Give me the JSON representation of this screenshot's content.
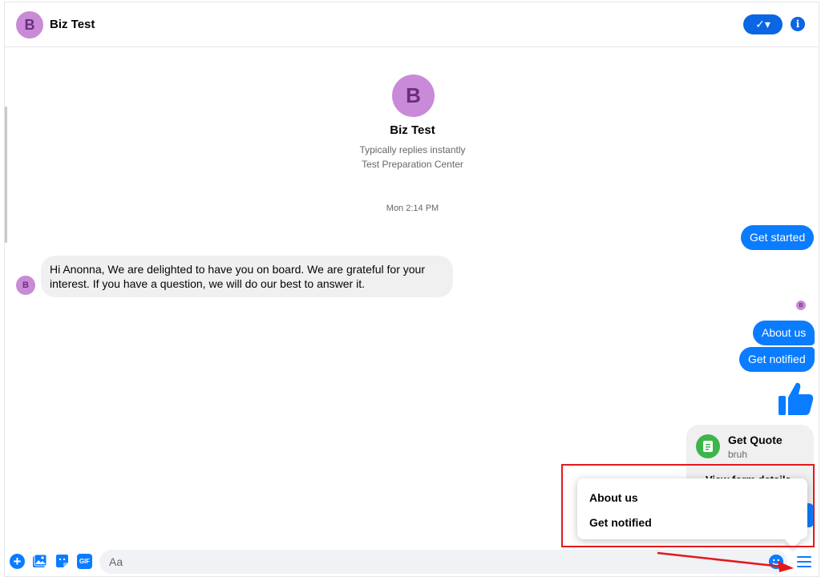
{
  "header": {
    "avatar_initial": "B",
    "title": "Biz Test",
    "check_label": "✓▾",
    "info_glyph": "i"
  },
  "profile": {
    "avatar_initial": "B",
    "name": "Biz Test",
    "reply_status": "Typically replies instantly",
    "category": "Test Preparation Center"
  },
  "conversation": {
    "timestamp": "Mon 2:14 PM",
    "messages": [
      {
        "from": "me",
        "text": "Get started"
      },
      {
        "from": "page",
        "avatar_initial": "B",
        "text": "Hi Anonna, We are delighted to have you on board. We are grateful for your interest. If you have a question, we will do our best to answer it."
      },
      {
        "from": "me",
        "text": "About us"
      },
      {
        "from": "me",
        "text": "Get notified"
      }
    ],
    "read_receipt_initial": "B",
    "quote_card": {
      "title": "Get Quote",
      "subtitle": "bruh",
      "action": "View form details"
    }
  },
  "persistent_menu": {
    "items": [
      "About us",
      "Get notified"
    ]
  },
  "composer": {
    "placeholder": "Aa",
    "gif_label": "GIF",
    "plus_glyph": "+"
  },
  "colors": {
    "accent": "#0a7cff",
    "header_button": "#0a66e2",
    "avatar_bg": "#c98ad7",
    "annotation_red": "#e3191c",
    "quote_icon_green": "#3cb54a"
  }
}
